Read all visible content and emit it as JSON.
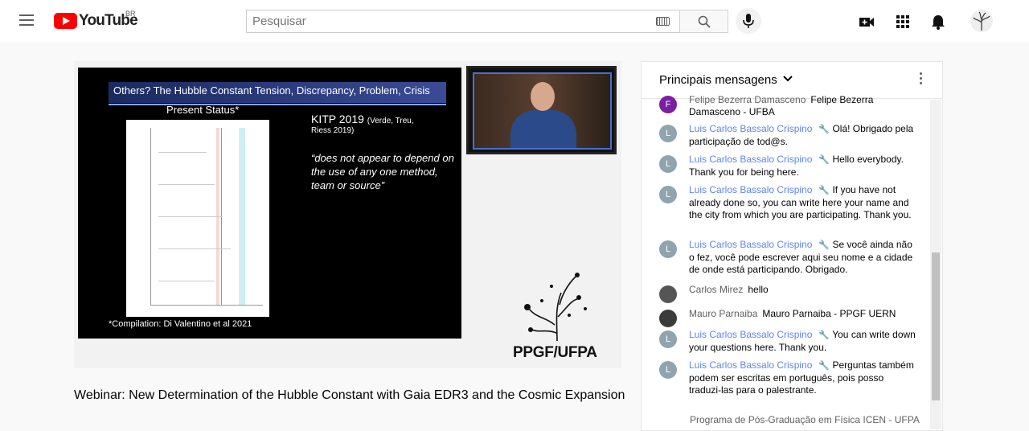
{
  "header": {
    "logo_text": "YouTube",
    "country": "BR",
    "search_placeholder": "Pesquisar"
  },
  "slide": {
    "title": "Others? The Hubble Constant Tension, Discrepancy, Problem, Crisis",
    "present_status": "Present Status*",
    "kitp_heading": "KITP 2019",
    "kitp_authors": "(Verde, Treu,",
    "kitp_authors2": "Riess 2019)",
    "quote": "“does not appear to depend on the use of any one method, team or source”",
    "compilation": "*Compilation: Di Valentino et al 2021",
    "logo": "PPGF/UFPA"
  },
  "video": {
    "title": "Webinar: New Determination of the Hubble Constant with Gaia EDR3 and the Cosmic Expansion"
  },
  "chat": {
    "header": "Principais mensagens",
    "messages": [
      {
        "initial": "F",
        "color": "#7b1fa2",
        "author": "Felipe Bezerra Damasceno",
        "text": "Felipe Bezerra Damasceno - UFBA",
        "owner": false
      },
      {
        "initial": "L",
        "color": "#90a4ae",
        "author": "Luis Carlos Bassalo Crispino",
        "text": "Olá! Obrigado pela participação de tod@s.",
        "owner": true
      },
      {
        "initial": "L",
        "color": "#90a4ae",
        "author": "Luis Carlos Bassalo Crispino",
        "text": "Hello everybody. Thank you for being here.",
        "owner": true
      },
      {
        "initial": "L",
        "color": "#90a4ae",
        "author": "Luis Carlos Bassalo Crispino",
        "text": "If you have not already done so, you can write here your name and the city from which you are participating. Thank you.",
        "owner": true
      },
      {
        "initial": "L",
        "color": "#90a4ae",
        "author": "Luis Carlos Bassalo Crispino",
        "text": "Se você ainda não o fez, você pode escrever aqui seu nome e a cidade de onde está participando. Obrigado.",
        "owner": true
      },
      {
        "initial": "",
        "color": "#555555",
        "author": "Carlos Mirez",
        "text": "hello",
        "owner": false
      },
      {
        "initial": "",
        "color": "#3b3b3b",
        "author": "Mauro Parnaiba",
        "text": "Mauro Parnaiba - PPGF UERN",
        "owner": false
      },
      {
        "initial": "L",
        "color": "#90a4ae",
        "author": "Luis Carlos Bassalo Crispino",
        "text": "You can write down your questions here. Thank you.",
        "owner": true
      },
      {
        "initial": "L",
        "color": "#90a4ae",
        "author": "Luis Carlos Bassalo Crispino",
        "text": "Perguntas também podem ser escritas em português, pois posso traduzi-las para o palestrante.",
        "owner": true
      }
    ],
    "next_partial": "Programa de Pós-Graduação em Física ICEN - UFPA"
  }
}
